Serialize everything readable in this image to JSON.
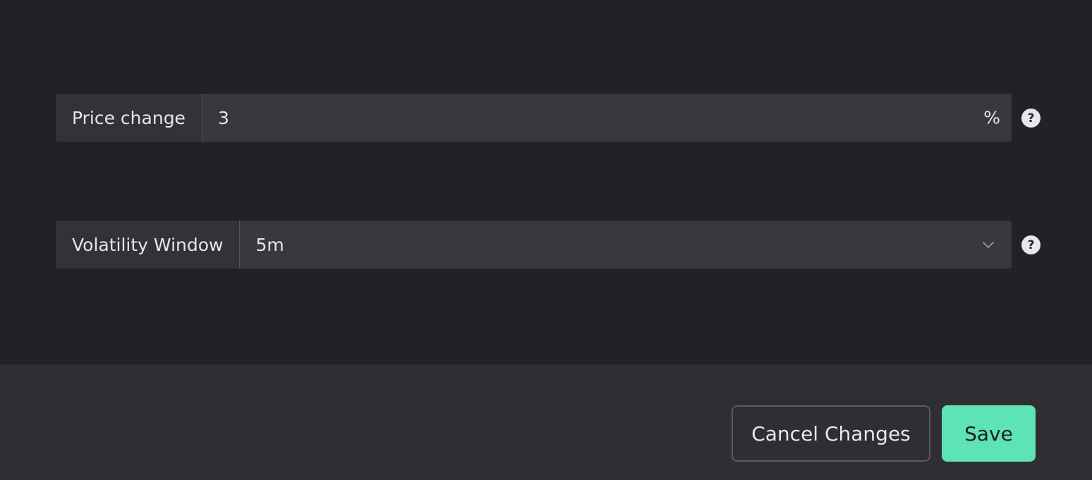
{
  "form": {
    "price_change": {
      "label": "Price change",
      "value": "3",
      "suffix": "%"
    },
    "volatility_window": {
      "label": "Volatility Window",
      "value": "5m"
    },
    "help_glyph": "?"
  },
  "footer": {
    "cancel_label": "Cancel Changes",
    "save_label": "Save"
  },
  "colors": {
    "background": "#222226",
    "field": "#38383e",
    "footer": "#2e2e33",
    "accent": "#5de3b5"
  }
}
